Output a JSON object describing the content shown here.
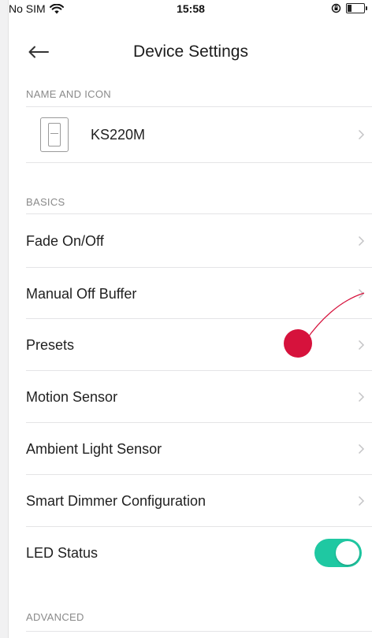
{
  "status_bar": {
    "carrier": "No SIM",
    "time": "15:58",
    "battery_level": 0.25,
    "icons": [
      "wifi-icon",
      "orientation-lock-icon",
      "battery-icon"
    ]
  },
  "header": {
    "title": "Device Settings",
    "back_icon": "back-arrow-icon"
  },
  "sections": {
    "name_and_icon": {
      "title": "NAME AND ICON",
      "device_name": "KS220M"
    },
    "basics": {
      "title": "BASICS",
      "items": [
        {
          "label": "Fade On/Off"
        },
        {
          "label": "Manual Off Buffer"
        },
        {
          "label": "Presets"
        },
        {
          "label": "Motion Sensor"
        },
        {
          "label": "Ambient Light Sensor"
        },
        {
          "label": "Smart Dimmer Configuration"
        }
      ],
      "led_status": {
        "label": "LED Status",
        "enabled": true
      }
    },
    "advanced": {
      "title": "ADVANCED"
    }
  },
  "colors": {
    "toggle_on": "#1fc8a2",
    "touch_indicator": "#d6123c",
    "section_text": "#8a8a8a"
  }
}
